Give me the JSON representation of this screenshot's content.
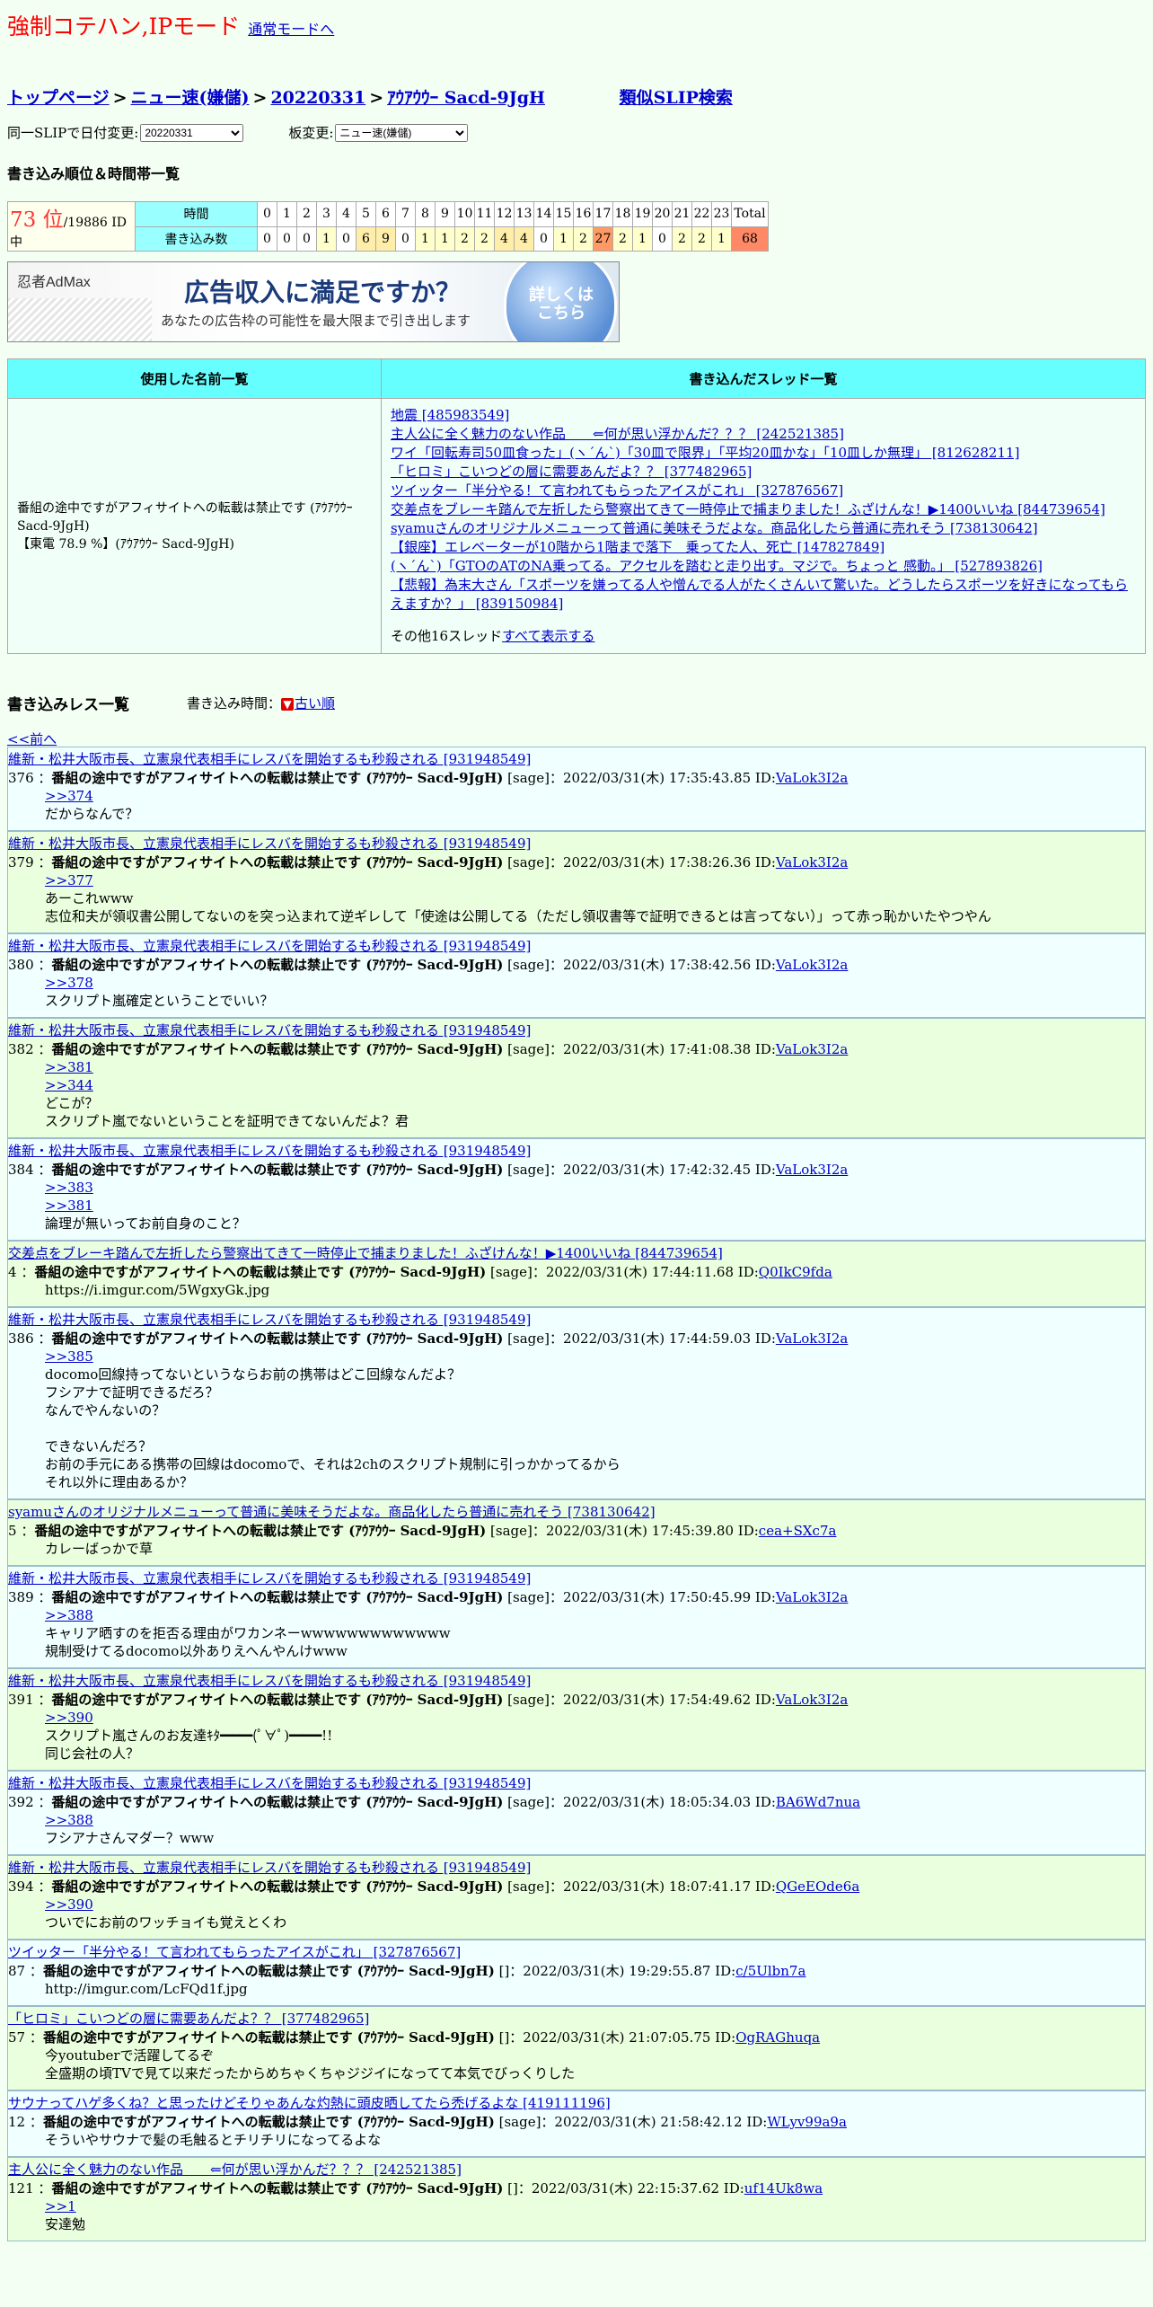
{
  "header": {
    "mode_title": "強制コテハン,IPモード",
    "mode_link": "通常モードへ"
  },
  "breadcrumb": {
    "top": "トップページ",
    "board": "ニュー速(嫌儲)",
    "date": "20220331",
    "slip": "ｱｳｱｳｳｰ Sacd-9JgH",
    "similar": "類似SLIP検索",
    "sep": ">"
  },
  "selectors": {
    "date_label": "同一SLIPで日付変更:",
    "date_value": "20220331",
    "board_label": "板変更:",
    "board_value": "ニュー速(嫌儲)"
  },
  "rank": {
    "heading": "書き込み順位＆時間帯一覧",
    "position": "73 位",
    "total_ids": "/19886 ID中",
    "hour_label": "時間",
    "count_label": "書き込み数",
    "hours": [
      "0",
      "1",
      "2",
      "3",
      "4",
      "5",
      "6",
      "7",
      "8",
      "9",
      "10",
      "11",
      "12",
      "13",
      "14",
      "15",
      "16",
      "17",
      "18",
      "19",
      "20",
      "21",
      "22",
      "23",
      "Total"
    ],
    "counts": [
      "0",
      "0",
      "0",
      "1",
      "0",
      "6",
      "9",
      "0",
      "1",
      "1",
      "2",
      "2",
      "4",
      "4",
      "0",
      "1",
      "2",
      "27",
      "2",
      "1",
      "0",
      "2",
      "2",
      "1",
      "68"
    ]
  },
  "ad": {
    "logo": "忍者AdMax",
    "title": "広告収入に満足ですか？",
    "subtitle": "あなたの広告枠の可能性を最大限まで引き出します",
    "button": "詳しくはこちら"
  },
  "names_table": {
    "col_names": "使用した名前一覧",
    "col_threads": "書き込んだスレッド一覧",
    "name_line1": "番組の途中ですがアフィサイトへの転載は禁止です (ｱｳｱｳｳｰ Sacd-9JgH)",
    "name_line2": "【東電 78.9 %】(ｱｳｱｳｳｰ Sacd-9JgH)",
    "threads": [
      "地震 [485983549]",
      "主人公に全く魅力のない作品　　⇐何が思い浮かんだ？？？ [242521385]",
      "ワイ「回転寿司50皿食った」(ヽ´ん`)「30皿で限界」「平均20皿かな」「10皿しか無理」 [812628211]",
      "「ヒロミ」こいつどの層に需要あんだよ？？ [377482965]",
      "ツイッター「半分やる！て言われてもらったアイスがこれ」 [327876567]",
      "交差点をブレーキ踏んで左折したら警察出てきて一時停止で捕まりました！ふざけんな！▶1400いいね [844739654]",
      "syamuさんのオリジナルメニューって普通に美味そうだよな。商品化したら普通に売れそう [738130642]",
      "【銀座】エレベーターが10階から1階まで落下　乗ってた人、死亡 [147827849]",
      "(ヽ´ん`)「GTOのATのNA乗ってる。アクセルを踏むと走り出す。マジで。ちょっと 感動。」 [527893826]",
      "【悲報】為末大さん「スポーツを嫌ってる人や憎んでる人がたくさんいて驚いた。どうしたらスポーツを好きになってもらえますか？」 [839150984]"
    ],
    "more_prefix": "その他16スレッド",
    "more_link": "すべて表示する"
  },
  "posts_section": {
    "heading": "書き込みレス一覧",
    "time_label": "書き込み時間：",
    "sort_link": "古い順",
    "prev": "<<前へ"
  },
  "posts": [
    {
      "thread": "維新・松井大阪市長、立憲泉代表相手にレスバを開始するも秒殺される [931948549]",
      "num": "376",
      "name": "番組の途中ですがアフィサイトへの転載は禁止です (ｱｳｱｳｳｰ Sacd-9JgH)",
      "meta": "[sage]：2022/03/31(木) 17:35:43.85 ID:",
      "id": "VaLok3I2a",
      "anchors": [
        ">>374"
      ],
      "lines": [
        "だからなんで？"
      ]
    },
    {
      "thread": "維新・松井大阪市長、立憲泉代表相手にレスバを開始するも秒殺される [931948549]",
      "num": "379",
      "name": "番組の途中ですがアフィサイトへの転載は禁止です (ｱｳｱｳｳｰ Sacd-9JgH)",
      "meta": "[sage]：2022/03/31(木) 17:38:26.36 ID:",
      "id": "VaLok3I2a",
      "anchors": [
        ">>377"
      ],
      "lines": [
        "あーこれwww",
        "志位和夫が領収書公開してないのを突っ込まれて逆ギレして「使途は公開してる（ただし領収書等で証明できるとは言ってない）」って赤っ恥かいたやつやん"
      ]
    },
    {
      "thread": "維新・松井大阪市長、立憲泉代表相手にレスバを開始するも秒殺される [931948549]",
      "num": "380",
      "name": "番組の途中ですがアフィサイトへの転載は禁止です (ｱｳｱｳｳｰ Sacd-9JgH)",
      "meta": "[sage]：2022/03/31(木) 17:38:42.56 ID:",
      "id": "VaLok3I2a",
      "anchors": [
        ">>378"
      ],
      "lines": [
        "スクリプト嵐確定ということでいい？"
      ]
    },
    {
      "thread": "維新・松井大阪市長、立憲泉代表相手にレスバを開始するも秒殺される [931948549]",
      "num": "382",
      "name": "番組の途中ですがアフィサイトへの転載は禁止です (ｱｳｱｳｳｰ Sacd-9JgH)",
      "meta": "[sage]：2022/03/31(木) 17:41:08.38 ID:",
      "id": "VaLok3I2a",
      "anchors": [
        ">>381",
        ">>344"
      ],
      "lines": [
        "どこが？",
        "スクリプト嵐でないということを証明できてないんだよ？君"
      ]
    },
    {
      "thread": "維新・松井大阪市長、立憲泉代表相手にレスバを開始するも秒殺される [931948549]",
      "num": "384",
      "name": "番組の途中ですがアフィサイトへの転載は禁止です (ｱｳｱｳｳｰ Sacd-9JgH)",
      "meta": "[sage]：2022/03/31(木) 17:42:32.45 ID:",
      "id": "VaLok3I2a",
      "anchors": [
        ">>383",
        ">>381"
      ],
      "lines": [
        "論理が無いってお前自身のこと？"
      ]
    },
    {
      "thread": "交差点をブレーキ踏んで左折したら警察出てきて一時停止で捕まりました！ふざけんな！▶1400いいね [844739654]",
      "num": "4",
      "name": "番組の途中ですがアフィサイトへの転載は禁止です (ｱｳｱｳｳｰ Sacd-9JgH)",
      "meta": "[sage]：2022/03/31(木) 17:44:11.68 ID:",
      "id": "Q0IkC9fda",
      "anchors": [],
      "lines": [
        "https://i.imgur.com/5WgxyGk.jpg"
      ]
    },
    {
      "thread": "維新・松井大阪市長、立憲泉代表相手にレスバを開始するも秒殺される [931948549]",
      "num": "386",
      "name": "番組の途中ですがアフィサイトへの転載は禁止です (ｱｳｱｳｳｰ Sacd-9JgH)",
      "meta": "[sage]：2022/03/31(木) 17:44:59.03 ID:",
      "id": "VaLok3I2a",
      "anchors": [
        ">>385"
      ],
      "lines": [
        "docomo回線持ってないというならお前の携帯はどこ回線なんだよ？",
        "フシアナで証明できるだろ？",
        "なんでやんないの？",
        "",
        "できないんだろ？",
        "お前の手元にある携帯の回線はdocomoで、それは2chのスクリプト規制に引っかかってるから",
        "それ以外に理由あるか？"
      ]
    },
    {
      "thread": "syamuさんのオリジナルメニューって普通に美味そうだよな。商品化したら普通に売れそう [738130642]",
      "num": "5",
      "name": "番組の途中ですがアフィサイトへの転載は禁止です (ｱｳｱｳｳｰ Sacd-9JgH)",
      "meta": "[sage]：2022/03/31(木) 17:45:39.80 ID:",
      "id": "cea+SXc7a",
      "anchors": [],
      "lines": [
        "カレーばっかで草"
      ]
    },
    {
      "thread": "維新・松井大阪市長、立憲泉代表相手にレスバを開始するも秒殺される [931948549]",
      "num": "389",
      "name": "番組の途中ですがアフィサイトへの転載は禁止です (ｱｳｱｳｳｰ Sacd-9JgH)",
      "meta": "[sage]：2022/03/31(木) 17:50:45.99 ID:",
      "id": "VaLok3I2a",
      "anchors": [
        ">>388"
      ],
      "lines": [
        "キャリア晒すのを拒否る理由がワカンネーwwwwwwwwwwwww",
        "規制受けてるdocomo以外ありえへんやんけwww"
      ]
    },
    {
      "thread": "維新・松井大阪市長、立憲泉代表相手にレスバを開始するも秒殺される [931948549]",
      "num": "391",
      "name": "番組の途中ですがアフィサイトへの転載は禁止です (ｱｳｱｳｳｰ Sacd-9JgH)",
      "meta": "[sage]：2022/03/31(木) 17:54:49.62 ID:",
      "id": "VaLok3I2a",
      "anchors": [
        ">>390"
      ],
      "lines": [
        "スクリプト嵐さんのお友達ｷﾀ━━━━(ﾟ∀ﾟ)━━━━!!",
        "同じ会社の人？"
      ]
    },
    {
      "thread": "維新・松井大阪市長、立憲泉代表相手にレスバを開始するも秒殺される [931948549]",
      "num": "392",
      "name": "番組の途中ですがアフィサイトへの転載は禁止です (ｱｳｱｳｳｰ Sacd-9JgH)",
      "meta": "[sage]：2022/03/31(木) 18:05:34.03 ID:",
      "id": "BA6Wd7nua",
      "anchors": [
        ">>388"
      ],
      "lines": [
        "フシアナさんマダー？www"
      ]
    },
    {
      "thread": "維新・松井大阪市長、立憲泉代表相手にレスバを開始するも秒殺される [931948549]",
      "num": "394",
      "name": "番組の途中ですがアフィサイトへの転載は禁止です (ｱｳｱｳｳｰ Sacd-9JgH)",
      "meta": "[sage]：2022/03/31(木) 18:07:41.17 ID:",
      "id": "QGeEOde6a",
      "anchors": [
        ">>390"
      ],
      "lines": [
        "ついでにお前のワッチョイも覚えとくわ"
      ]
    },
    {
      "thread": "ツイッター「半分やる！て言われてもらったアイスがこれ」 [327876567]",
      "num": "87",
      "name": "番組の途中ですがアフィサイトへの転載は禁止です (ｱｳｱｳｳｰ Sacd-9JgH)",
      "meta": "[]：2022/03/31(木) 19:29:55.87 ID:",
      "id": "c/5Ulbn7a",
      "anchors": [],
      "lines": [
        "http://imgur.com/LcFQd1f.jpg"
      ]
    },
    {
      "thread": "「ヒロミ」こいつどの層に需要あんだよ？？ [377482965]",
      "num": "57",
      "name": "番組の途中ですがアフィサイトへの転載は禁止です (ｱｳｱｳｳｰ Sacd-9JgH)",
      "meta": "[]：2022/03/31(木) 21:07:05.75 ID:",
      "id": "OgRAGhuqa",
      "anchors": [],
      "lines": [
        "今youtuberで活躍してるぞ",
        "全盛期の頃TVで見て以来だったからめちゃくちゃジジイになってて本気でびっくりした"
      ]
    },
    {
      "thread": "サウナってハゲ多くね？と思ったけどそりゃあんな灼熱に頭皮晒してたら禿げるよな [419111196]",
      "num": "12",
      "name": "番組の途中ですがアフィサイトへの転載は禁止です (ｱｳｱｳｳｰ Sacd-9JgH)",
      "meta": "[sage]：2022/03/31(木) 21:58:42.12 ID:",
      "id": "WLyv99a9a",
      "anchors": [],
      "lines": [
        "そういやサウナで髪の毛触るとチリチリになってるよな"
      ]
    },
    {
      "thread": "主人公に全く魅力のない作品　　⇐何が思い浮かんだ？？？ [242521385]",
      "num": "121",
      "name": "番組の途中ですがアフィサイトへの転載は禁止です (ｱｳｱｳｳｰ Sacd-9JgH)",
      "meta": "[]：2022/03/31(木) 22:15:37.62 ID:",
      "id": "uf14Uk8wa",
      "anchors": [
        ">>1"
      ],
      "lines": [
        "安達勉"
      ]
    }
  ]
}
